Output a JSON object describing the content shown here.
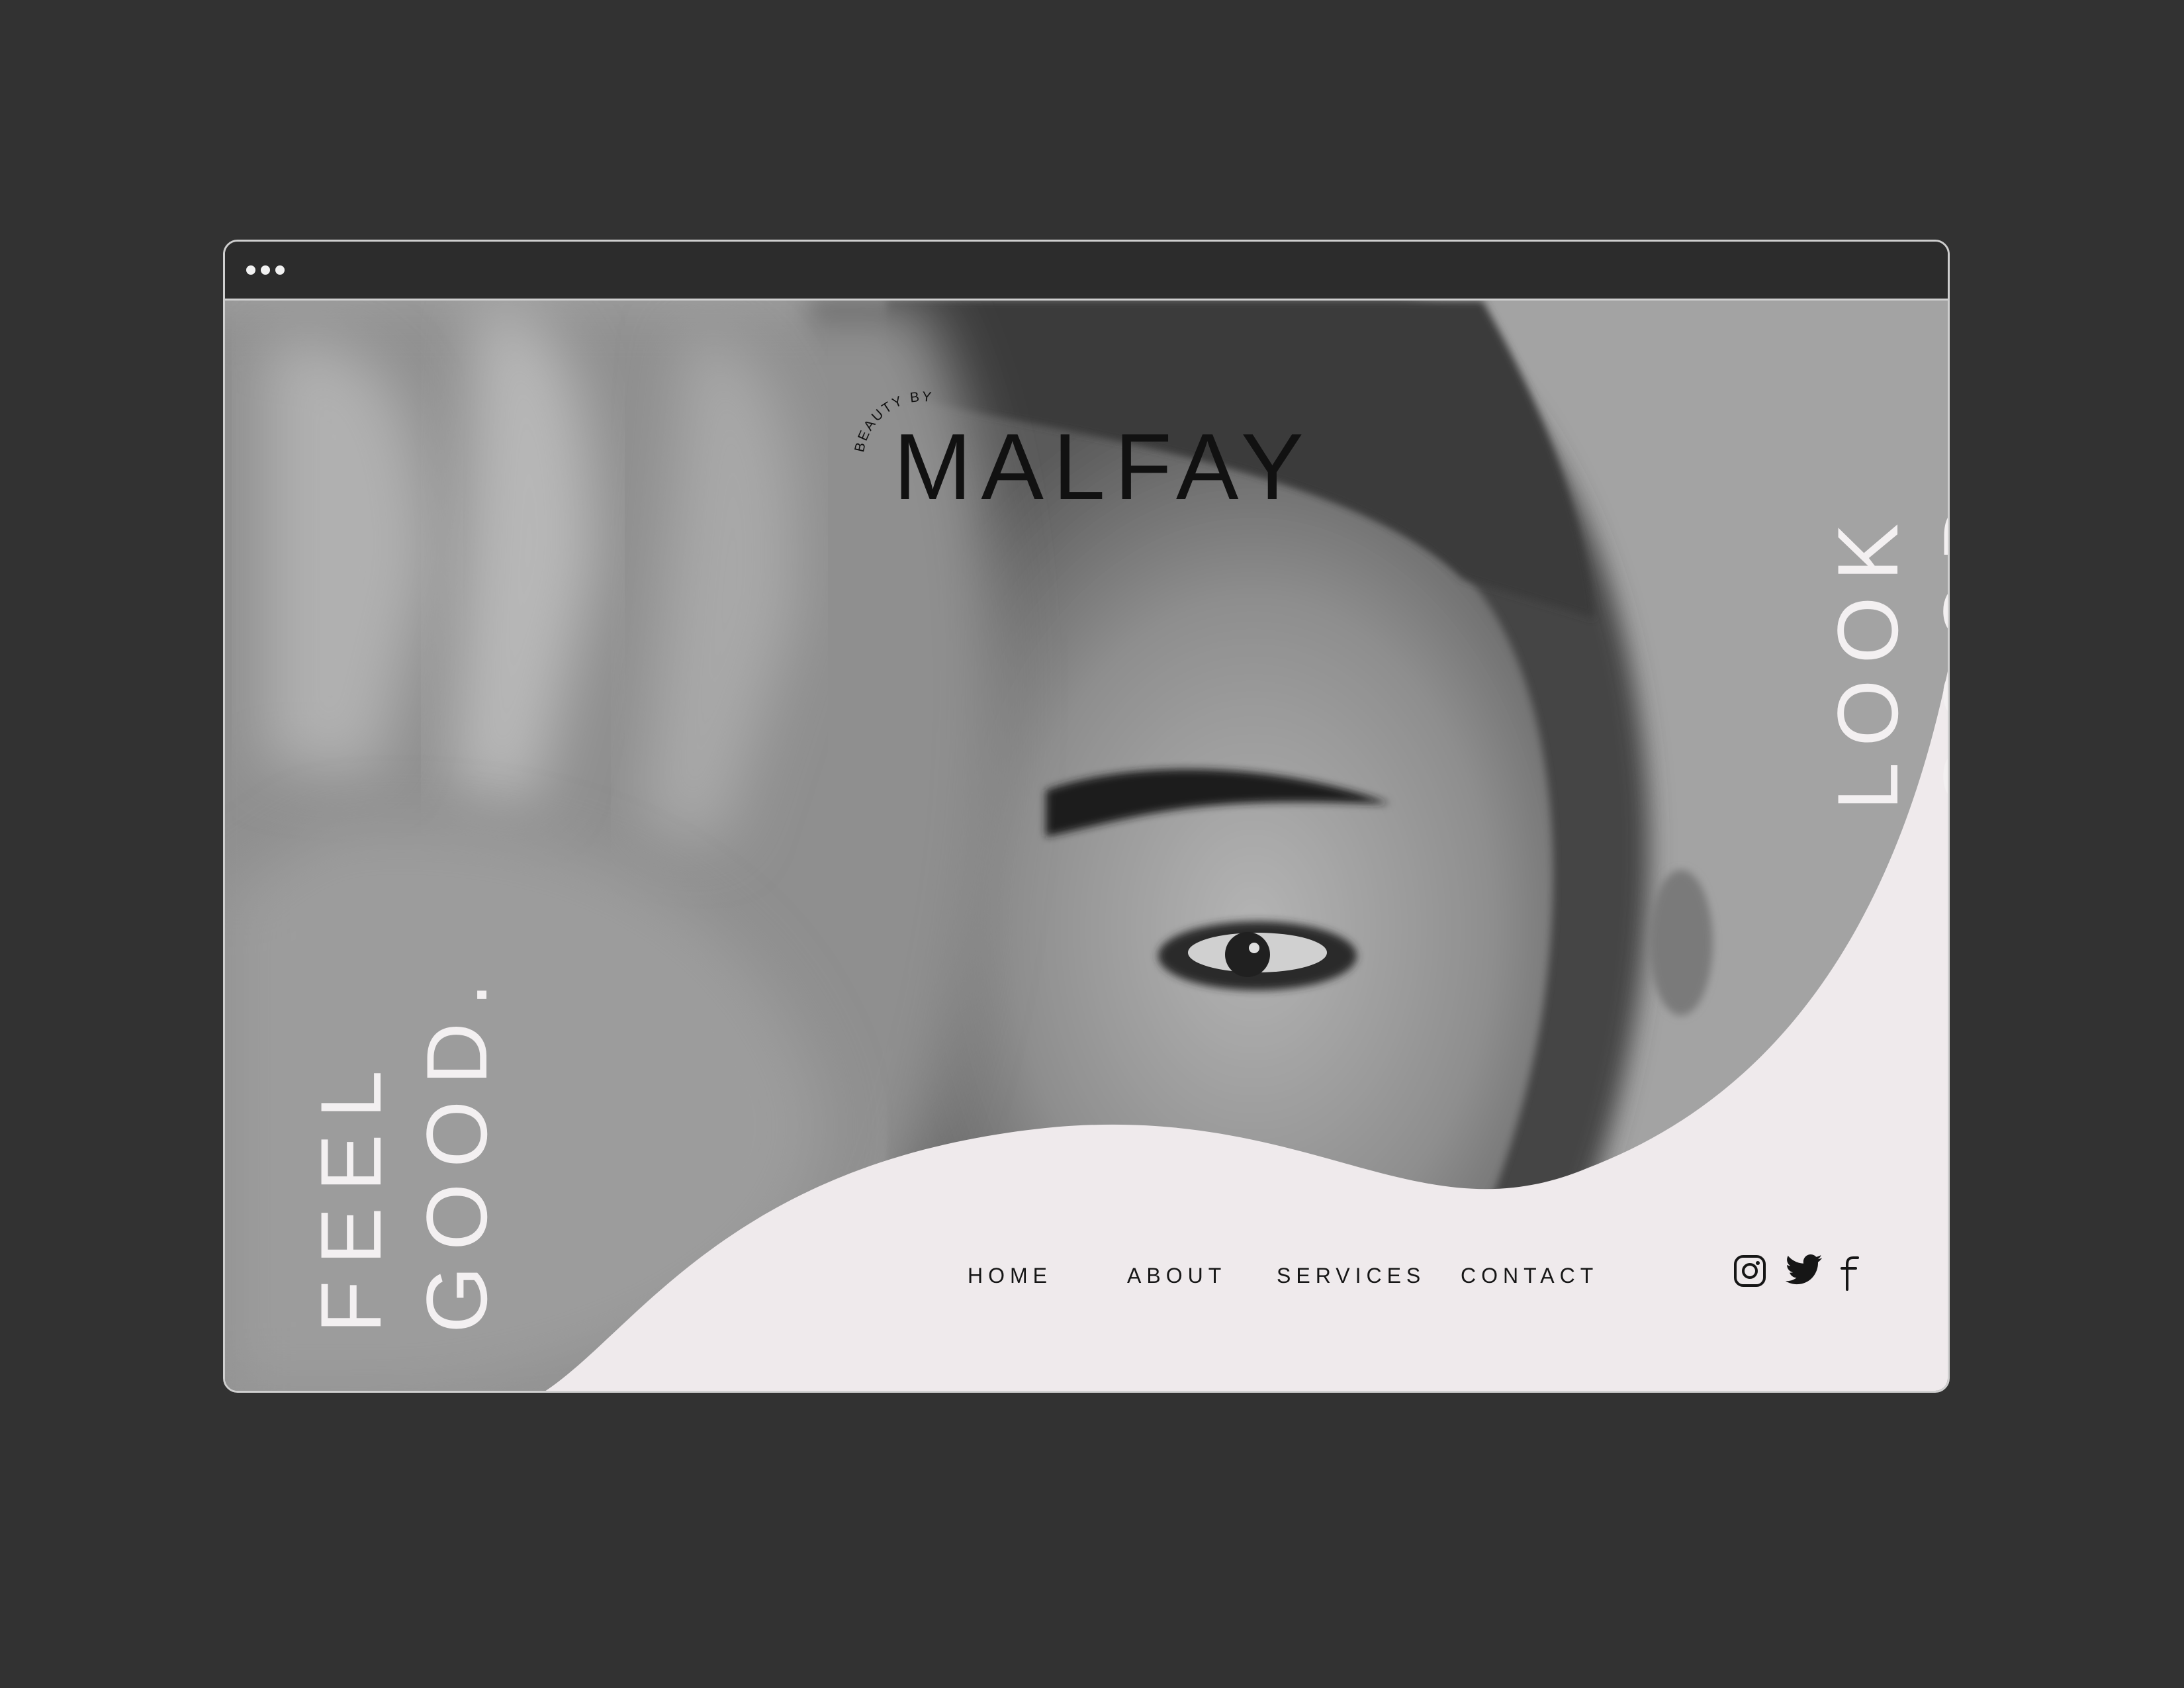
{
  "browser": {
    "window_dots": [
      "dot",
      "dot",
      "dot"
    ]
  },
  "hero": {
    "brand_prefix": "BEAUTY BY",
    "brand_name": "MALFAY",
    "tagline_right_line1": "LOOK",
    "tagline_right_line2": "GOOD.",
    "tagline_left_line1": "FEEL",
    "tagline_left_line2": "GOOD."
  },
  "nav": {
    "items": [
      {
        "label": "HOME"
      },
      {
        "label": "ABOUT"
      },
      {
        "label": "SERVICES"
      },
      {
        "label": "CONTACT"
      }
    ]
  },
  "social": {
    "icons": [
      "instagram-icon",
      "twitter-icon",
      "facebook-icon"
    ]
  },
  "colors": {
    "background": "#323232",
    "panel": "#efeaec",
    "text_light": "#f3f0f1",
    "text_dark": "#161616"
  }
}
